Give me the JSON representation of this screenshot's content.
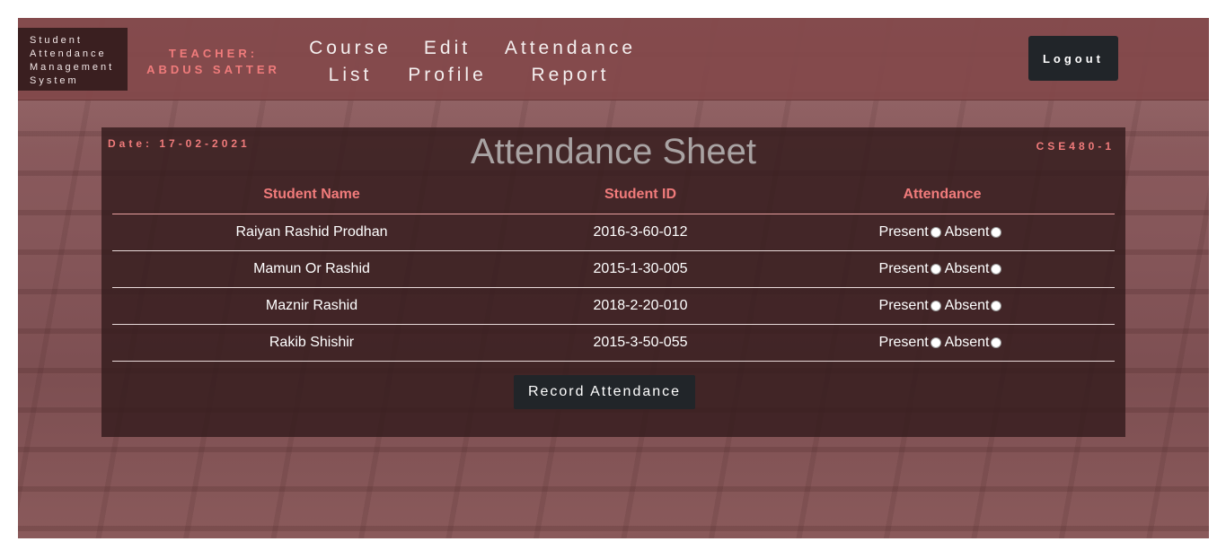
{
  "brand": {
    "lines": [
      "Student",
      "Attendance",
      "Management",
      "System"
    ]
  },
  "teacher": {
    "line1": "TEACHER:",
    "line2": "ABDUS SATTER"
  },
  "nav": {
    "course_list": {
      "line1": "Course",
      "line2": "List"
    },
    "edit_profile": {
      "line1": "Edit",
      "line2": "Profile"
    },
    "attendance_report": {
      "line1": "Attendance",
      "line2": "Report"
    }
  },
  "logout_label": "Logout",
  "sheet": {
    "date": "Date: 17-02-2021",
    "title": "Attendance Sheet",
    "course_code": "CSE480-1",
    "headers": {
      "name": "Student Name",
      "id": "Student ID",
      "attendance": "Attendance"
    },
    "present_label": "Present",
    "absent_label": "Absent",
    "rows": [
      {
        "name": "Raiyan Rashid Prodhan",
        "id": "2016-3-60-012"
      },
      {
        "name": "Mamun Or Rashid",
        "id": "2015-1-30-005"
      },
      {
        "name": "Maznir Rashid",
        "id": "2018-2-20-010"
      },
      {
        "name": "Rakib Shishir",
        "id": "2015-3-50-055"
      }
    ],
    "record_button": "Record Attendance"
  },
  "colors": {
    "accent": "#f07b7b",
    "topbar": "#82484a",
    "button": "#212529",
    "panel": "#321a1b"
  }
}
